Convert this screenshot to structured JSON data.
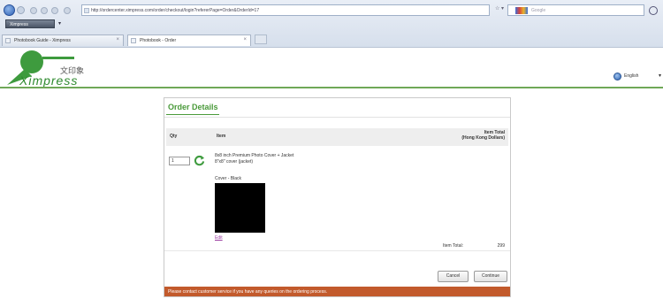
{
  "browser": {
    "url": "http://ordercenter.ximpress.com/order/checkout/login?refererPage=Order&OrderId=17",
    "search_placeholder": "Google",
    "menu_label": "Ximpress",
    "tabs": [
      {
        "label": "Photobook Guide - Ximpress"
      },
      {
        "label": "Photobook - Order"
      }
    ]
  },
  "site": {
    "logo_text": "Ximpress",
    "logo_chinese": "文印象",
    "language": "English"
  },
  "order": {
    "title": "Order Details",
    "columns": {
      "qty": "Qty",
      "item": "Item",
      "total_line1": "Item Total",
      "total_line2": "(Hong Kong Dollars)"
    },
    "item": {
      "qty": "1",
      "name": "8x8 inch Premium Photo Cover + Jacket",
      "paper": "8\"x8\" cover (jacket)",
      "cover": "Cover - Black",
      "edit": "Edit"
    },
    "item_total_label": "Item Total:",
    "item_total_value": "299",
    "cancel_label": "Cancel",
    "continue_label": "Continue",
    "notice": "Please contact customer service if you have any queries on the ordering process."
  },
  "colors": {
    "brand_green": "#4a9a3a",
    "notice_bar": "#c25a2c",
    "link_purple": "#9a3aa0"
  }
}
